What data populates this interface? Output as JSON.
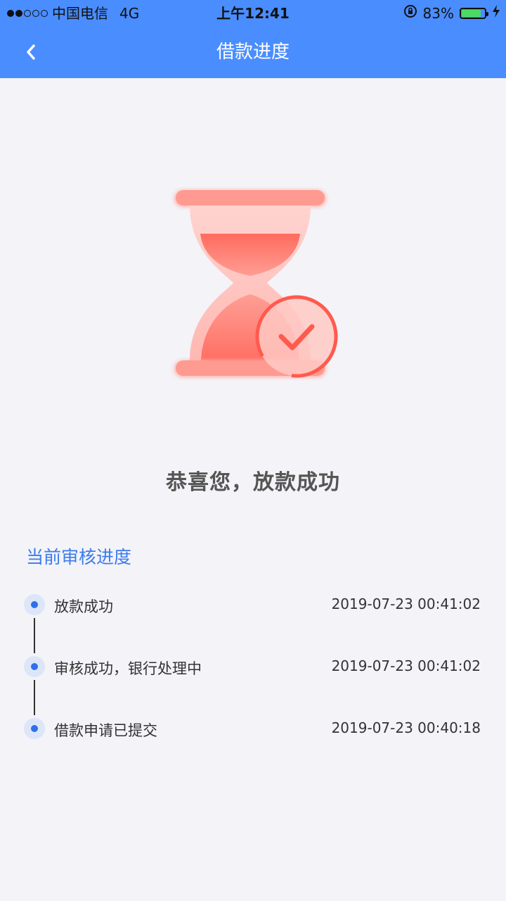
{
  "status_bar": {
    "carrier": "中国电信",
    "network": "4G",
    "time": "上午12:41",
    "battery_percent": "83%",
    "battery_level": 0.83,
    "signal_bars_filled": 2,
    "signal_bars_total": 5
  },
  "nav": {
    "title": "借款进度",
    "back_icon": "chevron-left-icon"
  },
  "illustration": {
    "icon": "hourglass-check-icon",
    "accent": "#ff5a4e"
  },
  "result": {
    "title": "恭喜您，放款成功"
  },
  "progress": {
    "section_title": "当前审核进度",
    "items": [
      {
        "label": "放款成功",
        "time": "2019-07-23 00:41:02"
      },
      {
        "label": "审核成功，银行处理中",
        "time": "2019-07-23 00:41:02"
      },
      {
        "label": "借款申请已提交",
        "time": "2019-07-23 00:40:18"
      }
    ]
  },
  "colors": {
    "brand": "#4a8dff",
    "section_title": "#3b7bef",
    "background": "#f3f3f8"
  }
}
